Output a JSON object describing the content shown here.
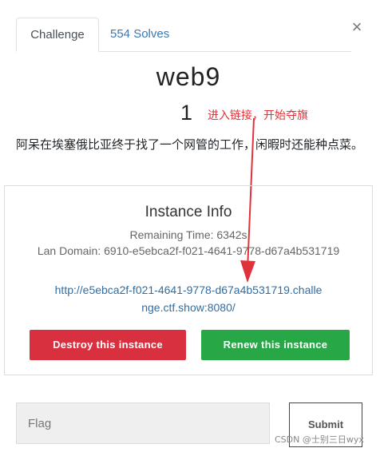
{
  "tabs": {
    "challenge": "Challenge",
    "solves": "554 Solves"
  },
  "close_symbol": "×",
  "challenge": {
    "name": "web9",
    "points": "1",
    "description": "阿呆在埃塞俄比亚终于找了一个网管的工作，闲暇时还能种点菜。"
  },
  "annotation": {
    "text": "进入链接，开始夺旗",
    "color": "#e0323a"
  },
  "instance": {
    "title": "Instance Info",
    "remaining_time": "Remaining Time: 6342s",
    "lan_domain": "Lan Domain: 6910-e5ebca2f-f021-4641-9778-d67a4b531719",
    "url": "http://e5ebca2f-f021-4641-9778-d67a4b531719.challenge.ctf.show:8080/",
    "destroy_label": "Destroy this instance",
    "renew_label": "Renew this instance"
  },
  "flag": {
    "placeholder": "Flag",
    "submit_label": "Submit"
  },
  "watermark": "CSDN @士别三日wyx",
  "colors": {
    "destroy": "#d9303f",
    "renew": "#27a745",
    "link": "#2f6ea5"
  }
}
